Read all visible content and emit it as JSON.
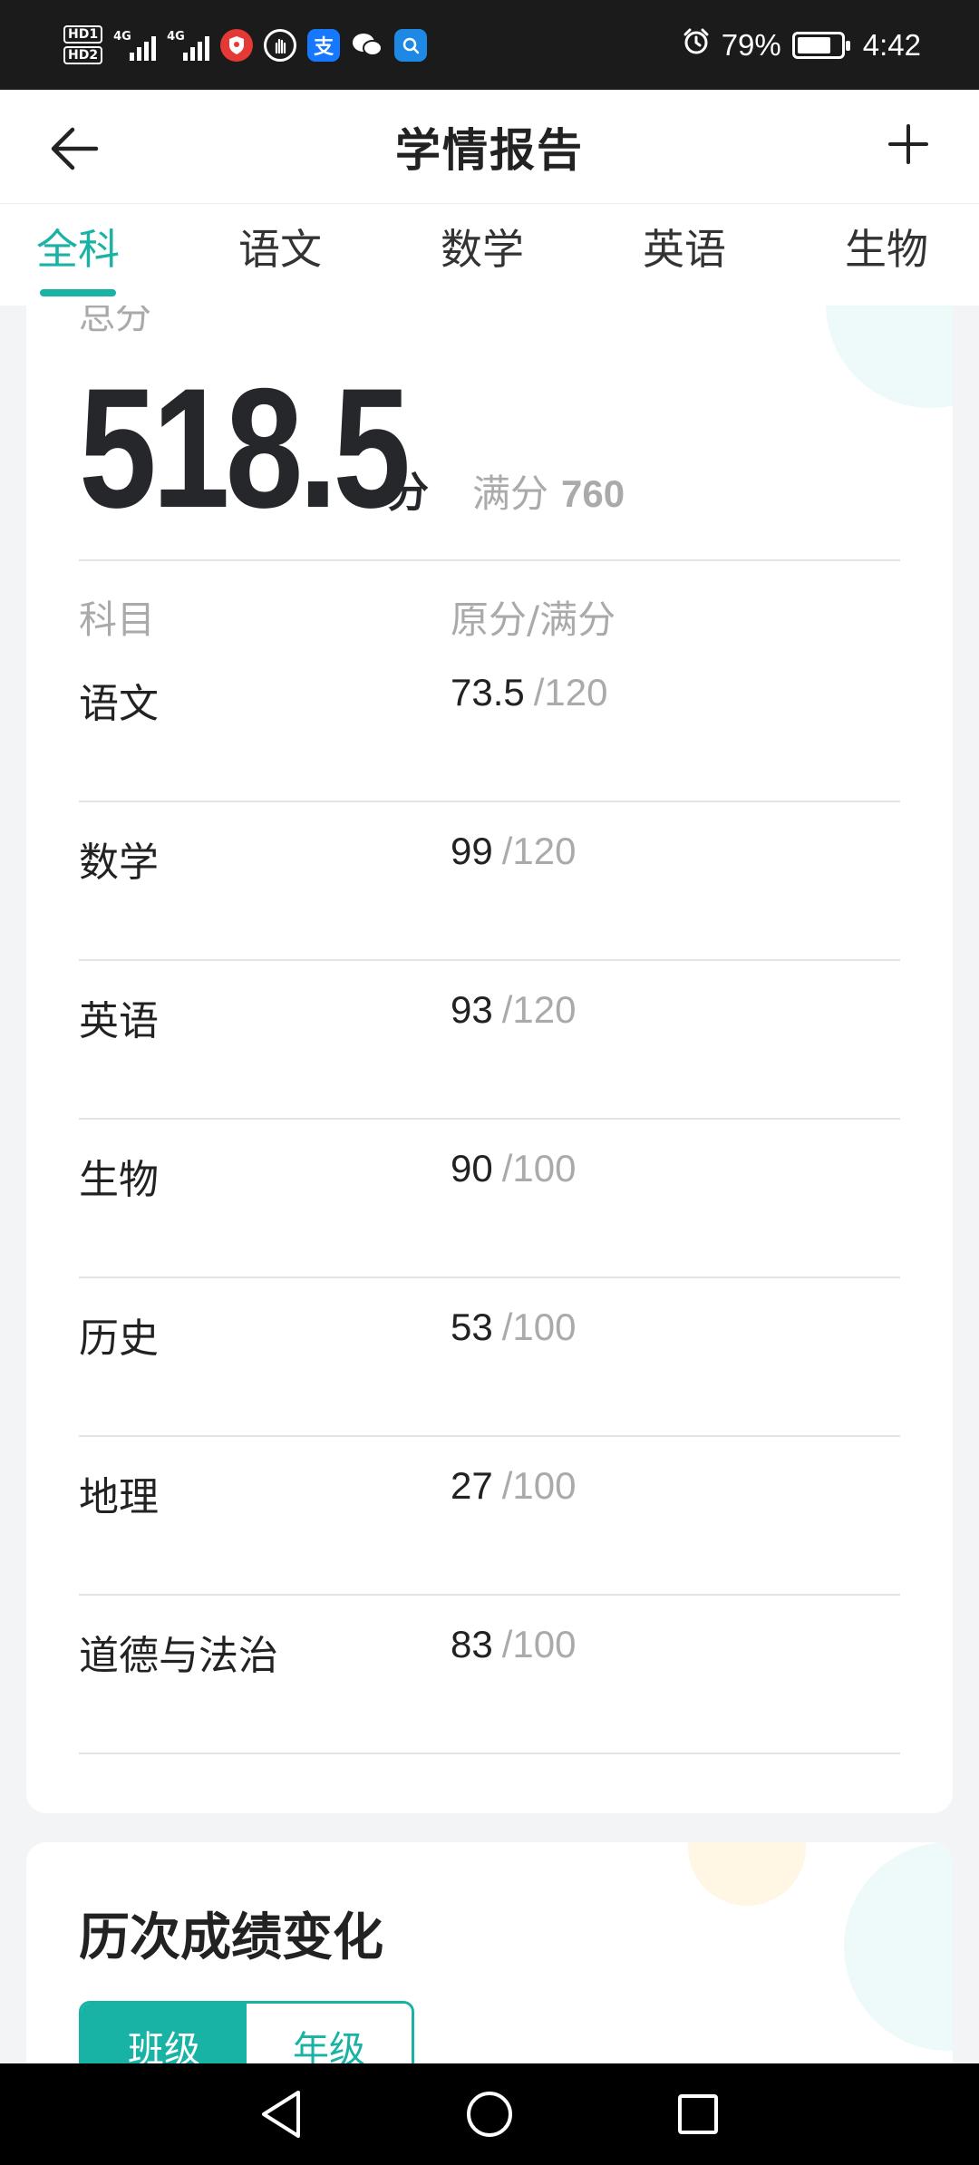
{
  "status_bar": {
    "hd1": "HD1",
    "hd2": "HD2",
    "signal1_tag": "4G",
    "signal2_tag": "4G",
    "battery_percent": "79%",
    "battery_level": 0.79,
    "time": "4:42",
    "notification_icons": [
      "security-shield-icon",
      "hand-icon",
      "alipay-icon",
      "wechat-icon",
      "search-app-icon"
    ],
    "alipay_glyph": "支"
  },
  "header": {
    "title": "学情报告"
  },
  "tabs": [
    {
      "label": "全科",
      "active": true
    },
    {
      "label": "语文",
      "active": false
    },
    {
      "label": "数学",
      "active": false
    },
    {
      "label": "英语",
      "active": false
    },
    {
      "label": "生物",
      "active": false
    }
  ],
  "summary": {
    "total_label": "总分",
    "total_score": "518.5",
    "unit": "分",
    "full_label": "满分",
    "full_value": "760"
  },
  "table": {
    "headers": [
      "科目",
      "原分/满分"
    ],
    "rows": [
      {
        "subject": "语文",
        "score": "73.5",
        "max": "/120"
      },
      {
        "subject": "数学",
        "score": "99",
        "max": "/120"
      },
      {
        "subject": "英语",
        "score": "93",
        "max": "/120"
      },
      {
        "subject": "生物",
        "score": "90",
        "max": "/100"
      },
      {
        "subject": "历史",
        "score": "53",
        "max": "/100"
      },
      {
        "subject": "地理",
        "score": "27",
        "max": "/100"
      },
      {
        "subject": "道德与法治",
        "score": "83",
        "max": "/100"
      }
    ]
  },
  "history": {
    "title": "历次成绩变化",
    "segments": [
      {
        "label": "班级",
        "active": true
      },
      {
        "label": "年级",
        "active": false
      }
    ]
  },
  "colors": {
    "accent": "#19b3a5",
    "text_primary": "#222222",
    "text_muted": "#aaaaaa",
    "divider": "#e4e4e4"
  }
}
